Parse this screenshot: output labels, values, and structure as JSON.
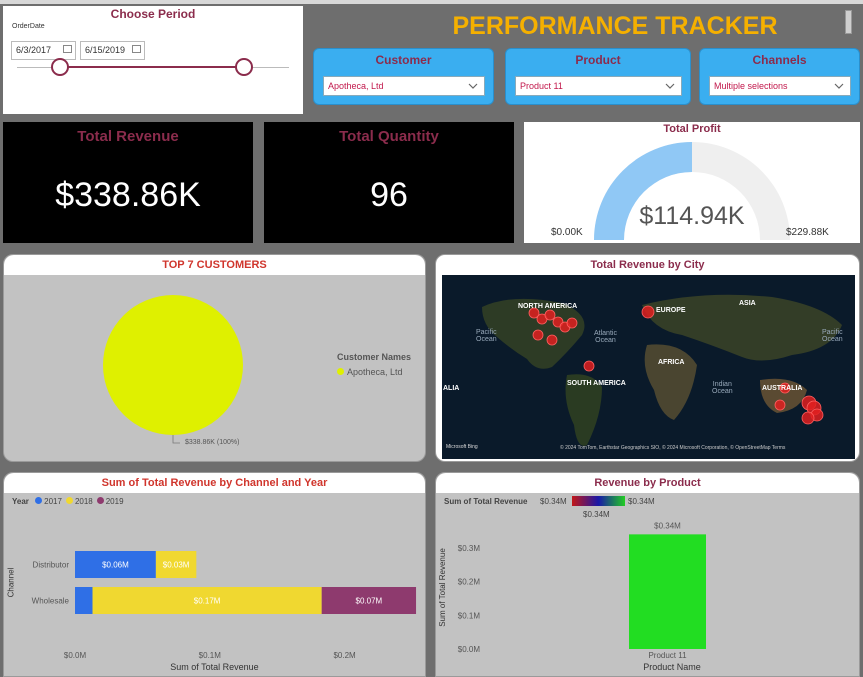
{
  "header": {
    "title": "PERFORMANCE TRACKER"
  },
  "period": {
    "title": "Choose Period",
    "field_label": "OrderDate",
    "start_date": "6/3/2017",
    "end_date": "6/15/2019"
  },
  "slicers": {
    "customer": {
      "title": "Customer",
      "value": "Apotheca, Ltd"
    },
    "product": {
      "title": "Product",
      "value": "Product 11"
    },
    "channels": {
      "title": "Channels",
      "value": "Multiple selections"
    }
  },
  "kpis": {
    "total_revenue": {
      "title": "Total Revenue",
      "value": "$338.86K"
    },
    "total_quantity": {
      "title": "Total Quantity",
      "value": "96"
    }
  },
  "profit_gauge": {
    "title": "Total Profit",
    "value_label": "$114.94K",
    "min_label": "$0.00K",
    "max_label": "$229.88K",
    "fraction": 0.5
  },
  "top_customers": {
    "title": "TOP 7 CUSTOMERS",
    "legend_title": "Customer Names",
    "legend_item": "Apotheca, Ltd",
    "slice_label": "$338.86K (100%)",
    "color": "#dff000"
  },
  "map": {
    "title": "Total Revenue by City",
    "labels": {
      "north_america": "NORTH AMERICA",
      "europe": "EUROPE",
      "asia": "ASIA",
      "africa": "AFRICA",
      "south_america": "SOUTH AMERICA",
      "australia": "AUSTRALIA",
      "pacific_left": "Pacific\nOcean",
      "atlantic": "Atlantic\nOcean",
      "indian": "Indian\nOcean",
      "pacific_right": "Pacific\nOcean",
      "asia_left": "ALIA"
    },
    "attribution": "© 2024 TomTom, Earthstar Geographics SIO, © 2024 Microsoft Corporation, © OpenStreetMap Terms",
    "bing": "Microsoft Bing"
  },
  "channel_chart": {
    "title": "Sum of Total Revenue by Channel and Year",
    "legend_title": "Year",
    "xlabel": "Sum of Total Revenue",
    "ylabel": "Channel"
  },
  "product_chart": {
    "title": "Revenue by Product",
    "legend_title": "Sum of Total Revenue",
    "legend_min": "$0.34M",
    "legend_max": "$0.34M",
    "legend_mid": "$0.34M",
    "xlabel": "Product Name",
    "ylabel": "Sum of Total Revenue"
  },
  "colors": {
    "accent_gold": "#f5b000",
    "maroon": "#8b2c4c",
    "blue_2017": "#2f6fe6",
    "yellow_2018": "#f0d830",
    "purple_2019": "#8e3a6e",
    "green_bar": "#22dd22"
  },
  "chart_data": [
    {
      "type": "bar",
      "title": "Sum of Total Revenue by Channel and Year",
      "orientation": "horizontal",
      "stacked": true,
      "categories": [
        "Distributor",
        "Wholesale"
      ],
      "series": [
        {
          "name": "2017",
          "values": [
            0.06,
            0.013
          ],
          "labels": [
            "$0.06M",
            ""
          ]
        },
        {
          "name": "2018",
          "values": [
            0.03,
            0.17
          ],
          "labels": [
            "$0.03M",
            "$0.17M"
          ]
        },
        {
          "name": "2019",
          "values": [
            0,
            0.07
          ],
          "labels": [
            "",
            "$0.07M"
          ]
        }
      ],
      "xlabel": "Sum of Total Revenue",
      "ylabel": "Channel",
      "xlim": [
        0,
        0.25
      ],
      "xticks": [
        "$0.0M",
        "$0.1M",
        "$0.2M"
      ],
      "xtick_values": [
        0,
        0.1,
        0.2
      ]
    },
    {
      "type": "bar",
      "title": "Revenue by Product",
      "categories": [
        "Product 11"
      ],
      "values": [
        0.34
      ],
      "data_labels": [
        "$0.34M"
      ],
      "xlabel": "Product Name",
      "ylabel": "Sum of Total Revenue",
      "ylim": [
        0,
        0.35
      ],
      "yticks": [
        "$0.0M",
        "$0.1M",
        "$0.2M",
        "$0.3M"
      ],
      "ytick_values": [
        0,
        0.1,
        0.2,
        0.3
      ]
    },
    {
      "type": "pie",
      "title": "TOP 7 CUSTOMERS",
      "categories": [
        "Apotheca, Ltd"
      ],
      "values": [
        338.86
      ],
      "percent": [
        100
      ]
    }
  ]
}
